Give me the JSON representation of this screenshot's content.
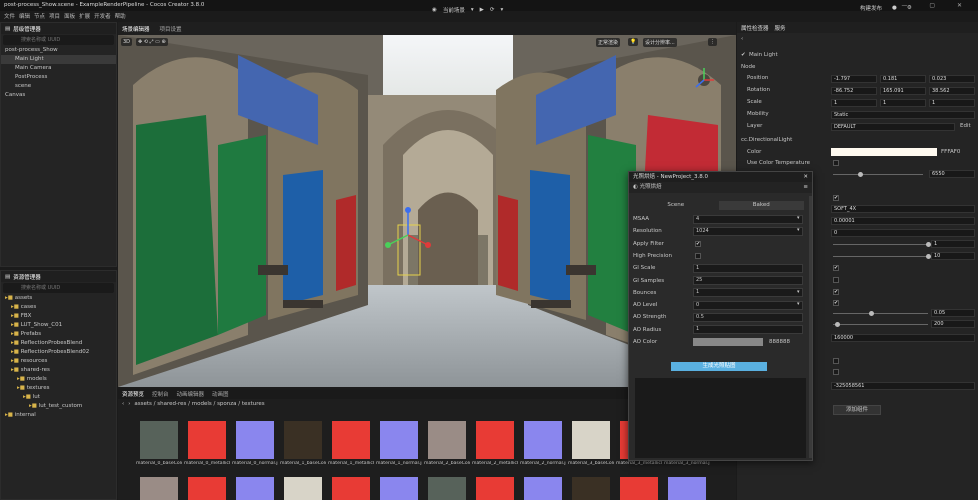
{
  "app": {
    "title": "post-process_Show.scene - ExampleRenderPipeline - Cocos Creator 3.8.0",
    "menu": [
      "文件",
      "编辑",
      "节点",
      "项目",
      "面板",
      "扩展",
      "开发者",
      "帮助"
    ],
    "toolbar_scene_select": "当前场景",
    "toolbar_right": "构建发布",
    "window_controls": "— ▢ ✕"
  },
  "hierarchy": {
    "tab_label": "层级管理器",
    "search_placeholder": "搜索名称或 UUID",
    "items": [
      {
        "label": "post-process_Show",
        "depth": 0,
        "selected": false
      },
      {
        "label": "Main Light",
        "depth": 1,
        "selected": true
      },
      {
        "label": "Main Camera",
        "depth": 1,
        "selected": false
      },
      {
        "label": "PostProcess",
        "depth": 1,
        "selected": false
      },
      {
        "label": "scene",
        "depth": 1,
        "selected": false
      },
      {
        "label": "Canvas",
        "depth": 0,
        "selected": false
      }
    ]
  },
  "assets": {
    "tab_label": "资源管理器",
    "search_placeholder": "搜索名称或 UUID",
    "items": [
      {
        "label": "assets",
        "depth": 0
      },
      {
        "label": "cases",
        "depth": 1
      },
      {
        "label": "FBX",
        "depth": 1
      },
      {
        "label": "LUT_Show_C01",
        "depth": 1
      },
      {
        "label": "Prefabs",
        "depth": 1
      },
      {
        "label": "ReflectionProbesBlend",
        "depth": 1
      },
      {
        "label": "ReflectionProbesBlend02",
        "depth": 1
      },
      {
        "label": "resources",
        "depth": 1
      },
      {
        "label": "shared-res",
        "depth": 1
      },
      {
        "label": "models",
        "depth": 2
      },
      {
        "label": "textures",
        "depth": 2
      },
      {
        "label": "lut",
        "depth": 3
      },
      {
        "label": "lut_test_custom",
        "depth": 4
      },
      {
        "label": "internal",
        "depth": 0
      }
    ]
  },
  "scene_editor": {
    "tabs": [
      "场景编辑器",
      "项目设置"
    ],
    "btn_3d": "3D",
    "render_mode": "正常渲染",
    "camera_mode": "设计分辨率..."
  },
  "bottom": {
    "tabs": [
      "资源预览",
      "控制台",
      "动画编辑器",
      "动画图"
    ],
    "path": "assets / shared-res / models / sponza / textures",
    "thumbs": [
      {
        "name": "material_0_baseColor.png",
        "color": "#57625a"
      },
      {
        "name": "material_0_metallicRoughn...",
        "color": "#e83b35"
      },
      {
        "name": "material_0_normal.jpeg",
        "color": "#8a86ee"
      },
      {
        "name": "material_1_baseColor.png",
        "color": "#3a3024"
      },
      {
        "name": "material_1_metallicRoughn...",
        "color": "#e83b35"
      },
      {
        "name": "material_1_normal.jpeg",
        "color": "#8a86ee"
      },
      {
        "name": "material_2_baseColor.png",
        "color": "#9a8c86"
      },
      {
        "name": "material_2_metallicRoughn...",
        "color": "#e83b35"
      },
      {
        "name": "material_2_normal.jpeg",
        "color": "#8a86ee"
      },
      {
        "name": "material_3_baseColor.png",
        "color": "#d8d4c8"
      },
      {
        "name": "material_3_metallicRoughn...",
        "color": "#e83b35"
      },
      {
        "name": "material_3_normal.jpeg",
        "color": "#8a86ee"
      }
    ]
  },
  "inspector": {
    "tabs": [
      "属性检查器",
      "服务"
    ],
    "node_name": "Main Light",
    "node_section": "Node",
    "position": {
      "label": "Position",
      "x": "-1.797",
      "y": "0.181",
      "z": "0.023"
    },
    "rotation": {
      "label": "Rotation",
      "x": "-86.752",
      "y": "165.091",
      "z": "38.562"
    },
    "scale": {
      "label": "Scale",
      "x": "1",
      "y": "1",
      "z": "1"
    },
    "mobility": {
      "label": "Mobility",
      "value": "Static"
    },
    "layer": {
      "label": "Layer",
      "value": "DEFAULT",
      "edit": "Edit"
    },
    "component": "cc.DirectionalLight",
    "color": {
      "label": "Color",
      "value": "FFFAF0"
    },
    "use_color_temp": "Use Color Temperature",
    "values": [
      "6550",
      "SOFT_4X",
      "0.00001",
      "0",
      "1",
      "10",
      "0.05",
      "200",
      "160000",
      "-325058561"
    ],
    "slider_levels": {
      "temp": 0.3,
      "s1": 1.0,
      "s2": 1.0,
      "s3": 0.4,
      "s4": 0.05
    },
    "add_component": "添加组件"
  },
  "lightmap_dialog": {
    "title": "光照烘焙 - NewProject_3.8.0",
    "tab": "光照烘焙",
    "mode_tabs": [
      "Scene",
      "Baked"
    ],
    "fields": [
      {
        "label": "MSAA",
        "value": "4",
        "type": "select"
      },
      {
        "label": "Resolution",
        "value": "1024",
        "type": "select"
      },
      {
        "label": "Apply Filter",
        "value": "✔",
        "type": "check"
      },
      {
        "label": "High Precision",
        "value": "",
        "type": "check"
      },
      {
        "label": "GI Scale",
        "value": "1",
        "type": "input"
      },
      {
        "label": "GI Samples",
        "value": "25",
        "type": "input"
      },
      {
        "label": "Bounces",
        "value": "1",
        "type": "select"
      },
      {
        "label": "AO Level",
        "value": "0",
        "type": "select"
      },
      {
        "label": "AO Strength",
        "value": "0.5",
        "type": "input"
      },
      {
        "label": "AO Radius",
        "value": "1",
        "type": "input"
      },
      {
        "label": "AO Color",
        "value": "888888",
        "type": "color"
      }
    ],
    "bake_button": "生成光照贴图"
  }
}
